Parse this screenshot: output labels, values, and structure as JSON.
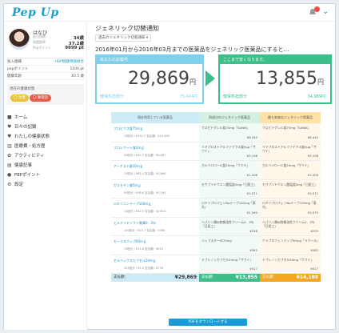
{
  "header": {
    "logo": "Pep Up"
  },
  "user": {
    "name": "はなび",
    "stats": [
      {
        "label": "先月歩数",
        "value": "34歳"
      },
      {
        "label": "体脂肪率",
        "value": "37.2歳"
      },
      {
        "label": "Pepポイント",
        "value": "9999 pt"
      }
    ]
  },
  "points": {
    "rows": [
      {
        "c1": "加入組織",
        "c2": "HDP健康保険組合"
      },
      {
        "c1": "pepポイント",
        "c2": "1100 pt"
      },
      {
        "c1": "健康年齢",
        "c2": "40.5 歳"
      }
    ]
  },
  "status": {
    "label": "現在の健康状態",
    "tag_yellow": "〇 注意",
    "tag_red": "〇 要受診"
  },
  "nav": [
    {
      "icon": "home-icon",
      "glyph": "■",
      "label": "ホーム"
    },
    {
      "icon": "heart-icon",
      "glyph": "♥",
      "label": "日々の記録"
    },
    {
      "icon": "heart-icon",
      "glyph": "♥",
      "label": "わたしの健康状態"
    },
    {
      "icon": "chart-icon",
      "glyph": "▥",
      "label": "医療費・処方歴"
    },
    {
      "icon": "activity-icon",
      "glyph": "✿",
      "label": "アクティビティ"
    },
    {
      "icon": "article-icon",
      "glyph": "▤",
      "label": "健康記事"
    },
    {
      "icon": "point-icon",
      "glyph": "●",
      "label": "PEPポイント"
    },
    {
      "icon": "gear-icon",
      "glyph": "⚙",
      "label": "設定"
    }
  ],
  "main": {
    "title": "ジェネリック切替通知",
    "dropdown": "過去のジェネリック切替通知 ▾",
    "subtitle": "2016年01月から2016年03月までの医薬品をジェネリック医薬品にすると…",
    "current": {
      "header": "あなたのお薬代",
      "amount": "29,869",
      "unit": "円",
      "footer_label": "健保負担部分",
      "footer_value": "75,424円"
    },
    "saving": {
      "header": "ここまで安くなります。",
      "amount": "13,855",
      "unit": "円",
      "footer_label": "健保負担部分",
      "footer_value": "34,989円"
    },
    "table": {
      "headers": [
        "現在利用している医薬品",
        "同成分のジェネリック医薬品",
        "最も安価なジェネリック医薬品"
      ],
      "rows": [
        {
          "drug": "プロピクス錠75ｍｇ",
          "sub": "15回分 / ¥330.7     支払額：¥13,066",
          "g1": "クロピドグレル錠75mg「SANIK」",
          "p1": "¥6,440",
          "g2": "クロピドグレル錠75mg「SANIK」",
          "p2": "¥6,440"
        },
        {
          "drug": "プロレクート錠2ｍｇ",
          "sub": "90回分 / ¥40.7      支払額：¥6,487",
          "g1": "リマプロストアルファデクス錠5μg「サワイ」",
          "p1": "¥3,198",
          "g2": "リマプロストアルファデクス錠5μg「サワイ」",
          "p2": "¥3,198"
        },
        {
          "drug": "アーチスト錠10ｍｇ",
          "sub": "15回分 / ¥62.4      支払額：¥2,869",
          "g1": "カルベジロール錠10mg「ＴＣＫ」",
          "p1": "¥1,206",
          "g2": "カルベジロール錠10mg「サワイ」",
          "p2": "¥1,206"
        },
        {
          "drug": "ガスモチン錠5ｍｇ",
          "sub": "90回分 / ¥18.6      支払額：¥2,192",
          "g1": "モサプリドクエン酸塩錠5mg「日医工」",
          "p1": "¥1,071",
          "g2": "モサプリドクエン酸塩錠5mg「日医工」",
          "p2": "¥1,071"
        },
        {
          "drug": "ロキソニンテープ100ｍｇ",
          "sub": "21回分 / ¥41.5      支払額：¥2,614",
          "g1": "ロキソプロフェンNaテープ100mg「東光」",
          "p1": "¥1,560",
          "g2": "ロキソプロフェンNaテープ100mg「東光」",
          "p2": "¥1,070"
        },
        {
          "drug": "ヒルドイドソフト軟膏0．3％",
          "sub": "100回分 / ¥23.7     支払額：¥768",
          "g1": "ヘパリン類似物質油性クリーム0．3％「日医工」",
          "p1": "¥236",
          "g2": "ヘパリン類似物質油性クリーム0．3％「日医工」",
          "p2": "¥205"
        },
        {
          "drug": "モーラスパップ60ｍｇ",
          "sub": "70回分 / ¥12.6      支払額：¥615",
          "g1": "ハップスターID70mg",
          "p1": "¥362",
          "g2": "ケトプロフェンパップ60mg「ラクール」",
          "p2": "¥362"
        },
        {
          "drug": "セルベックスカプセル50ｍｇ",
          "sub": "252回分 / ¥7.0      支払額：¥778",
          "g1": "テプレノンカプセル50mg「サワイ」",
          "p1": "¥417",
          "g2": "テプレノンカプセル50mg「サワイ」",
          "p2": "¥417"
        }
      ],
      "footer": {
        "label": "支払額：",
        "current": "¥29,869",
        "g1_label": "支払額：",
        "g1": "¥13,855",
        "g2_label": "支払額：",
        "g2": "¥14,188"
      }
    },
    "pdf_button": "PDFをダウンロードする"
  }
}
